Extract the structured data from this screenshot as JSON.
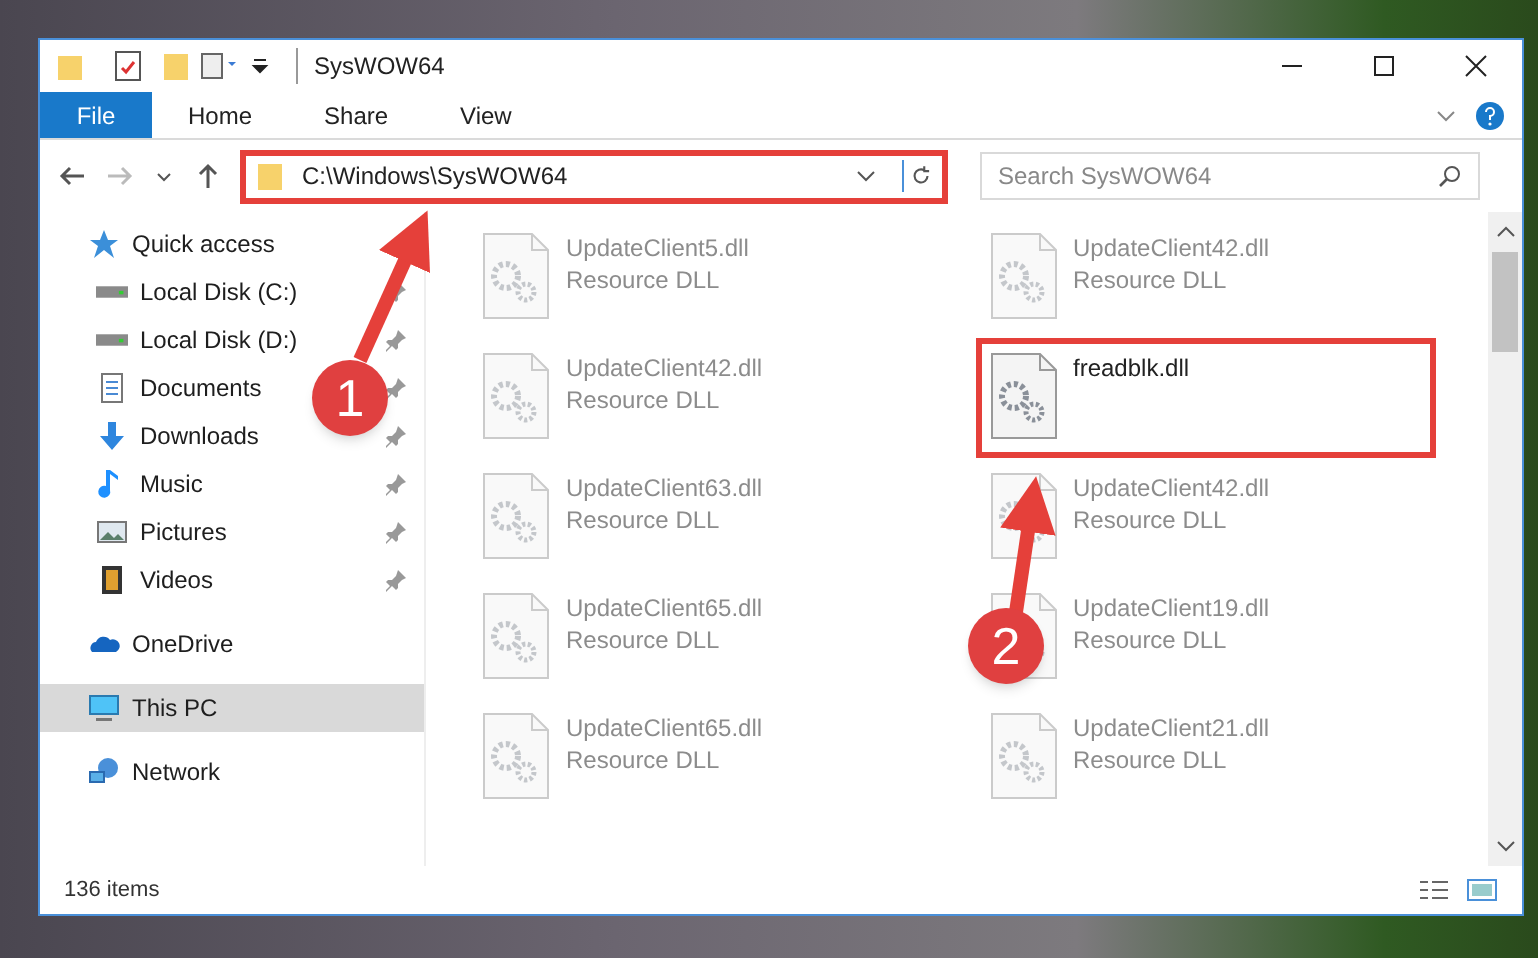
{
  "window": {
    "title": "SysWOW64"
  },
  "ribbon_tabs": [
    {
      "label": "File",
      "selected": true
    },
    {
      "label": "Home",
      "selected": false
    },
    {
      "label": "Share",
      "selected": false
    },
    {
      "label": "View",
      "selected": false
    }
  ],
  "address_bar": {
    "value": "C:\\Windows\\SysWOW64",
    "highlighted": true
  },
  "search": {
    "placeholder": "Search SysWOW64"
  },
  "navigation": [
    {
      "label": "Quick access",
      "kind": "star",
      "selected": false,
      "children": [
        {
          "label": "Local Disk (C:)",
          "kind": "disk",
          "pinned": true,
          "selected": false
        },
        {
          "label": "Local Disk (D:)",
          "kind": "disk",
          "pinned": true,
          "selected": false
        },
        {
          "label": "Documents",
          "kind": "documents",
          "pinned": true,
          "selected": false
        },
        {
          "label": "Downloads",
          "kind": "downloads",
          "pinned": true,
          "selected": false
        },
        {
          "label": "Music",
          "kind": "music",
          "pinned": true,
          "selected": false
        },
        {
          "label": "Pictures",
          "kind": "pictures",
          "pinned": true,
          "selected": false
        },
        {
          "label": "Videos",
          "kind": "videos",
          "pinned": true,
          "selected": false
        }
      ]
    },
    {
      "label": "OneDrive",
      "kind": "cloud",
      "selected": false
    },
    {
      "label": "This PC",
      "kind": "computer",
      "selected": true
    },
    {
      "label": "Network",
      "kind": "network",
      "selected": false
    }
  ],
  "files": [
    {
      "name": "UpdateClient5.dll",
      "type": "Resource DLL",
      "blurred": true,
      "highlighted": false
    },
    {
      "name": "UpdateClient42.dll",
      "type": "Resource DLL",
      "blurred": true,
      "highlighted": false
    },
    {
      "name": "UpdateClient42.dll",
      "type": "Resource DLL",
      "blurred": true,
      "highlighted": false
    },
    {
      "name": "freadblk.dll",
      "blurred": false,
      "highlighted": true
    },
    {
      "name": "UpdateClient63.dll",
      "type": "Resource DLL",
      "blurred": true,
      "highlighted": false
    },
    {
      "name": "UpdateClient42.dll",
      "type": "Resource DLL",
      "blurred": true,
      "highlighted": false
    },
    {
      "name": "UpdateClient65.dll",
      "type": "Resource DLL",
      "blurred": true,
      "highlighted": false
    },
    {
      "name": "UpdateClient19.dll",
      "type": "Resource DLL",
      "blurred": true,
      "highlighted": false
    },
    {
      "name": "UpdateClient65.dll",
      "type": "Resource DLL",
      "blurred": true,
      "highlighted": false
    },
    {
      "name": "UpdateClient21.dll",
      "type": "Resource DLL",
      "blurred": true,
      "highlighted": false
    }
  ],
  "callouts": [
    {
      "label": "1"
    },
    {
      "label": "2"
    }
  ],
  "status_bar": {
    "item_count": "136 items"
  }
}
